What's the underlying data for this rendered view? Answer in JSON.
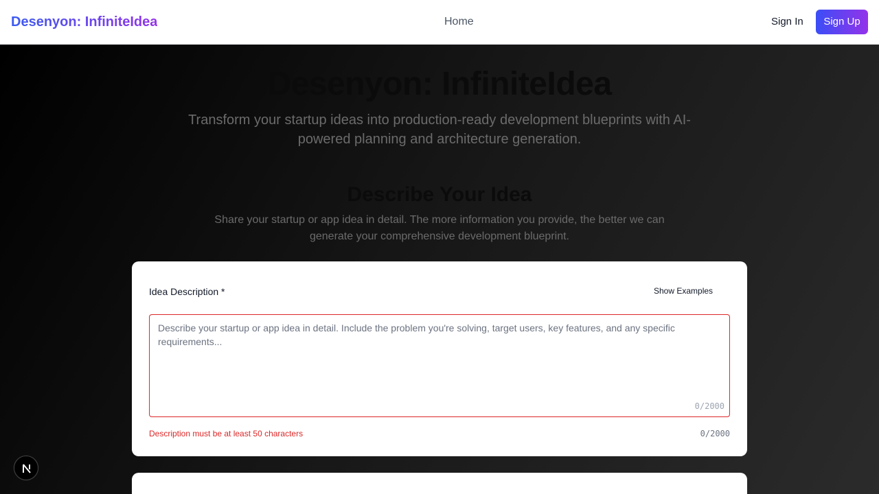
{
  "header": {
    "brand": "Desenyon: InfiniteIdea",
    "nav_home": "Home",
    "sign_in": "Sign In",
    "sign_up": "Sign Up"
  },
  "hero": {
    "title": "Desenyon: InfiniteIdea",
    "subtitle": "Transform your startup ideas into production-ready development blueprints with AI-powered planning and architecture generation."
  },
  "section": {
    "title": "Describe Your Idea",
    "subtitle": "Share your startup or app idea in detail. The more information you provide, the better we can generate your comprehensive development blueprint."
  },
  "form": {
    "label": "Idea Description *",
    "show_examples": "Show Examples",
    "placeholder": "Describe your startup or app idea in detail. Include the problem you're solving, target users, key features, and any specific requirements...",
    "inner_counter": "0/2000",
    "error": "Description must be at least 50 characters",
    "outer_counter": "0/2000"
  },
  "badge": {
    "icon": "nextjs-icon"
  },
  "colors": {
    "brand_start": "#3b5bf0",
    "brand_end": "#9333ea",
    "error": "#dc2626"
  }
}
